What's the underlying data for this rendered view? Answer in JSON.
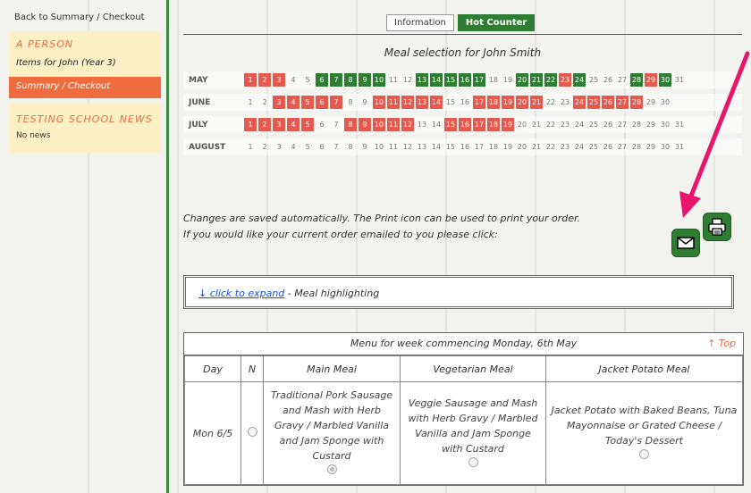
{
  "sidebar": {
    "back_link": "Back to Summary / Checkout",
    "person_heading": "A PERSON",
    "items_label": "Items for John (Year 3)",
    "summary_label": "Summary / Checkout",
    "news_heading": "TESTING SCHOOL NEWS",
    "news_body": "No news"
  },
  "tabs": [
    {
      "label": "Information",
      "active": false
    },
    {
      "label": "Hot Counter",
      "active": true
    }
  ],
  "meal_title": "Meal selection for John Smith",
  "calendar": [
    {
      "month": "MAY",
      "days": 31,
      "red": [
        1,
        2,
        3,
        7,
        8,
        9,
        10,
        13,
        14,
        15,
        16,
        17,
        20,
        21,
        22,
        23,
        24,
        28,
        29,
        30
      ],
      "green": [
        6,
        7,
        8,
        9,
        10,
        13,
        14,
        15,
        16,
        17,
        20,
        21,
        22,
        24,
        28,
        30
      ]
    },
    {
      "month": "JUNE",
      "days": 30,
      "red": [
        3,
        4,
        5,
        6,
        7,
        10,
        11,
        12,
        13,
        14,
        17,
        18,
        19,
        20,
        21,
        24,
        25,
        26,
        27,
        28
      ],
      "green": []
    },
    {
      "month": "JULY",
      "days": 31,
      "red": [
        1,
        2,
        3,
        4,
        5,
        8,
        9,
        10,
        11,
        12,
        15,
        16,
        17,
        18,
        19
      ],
      "green": []
    },
    {
      "month": "AUGUST",
      "days": 31,
      "red": [],
      "green": []
    }
  ],
  "info": {
    "line1": "Changes are saved automatically. The Print icon can be used to print your order.",
    "line2": "If you would like your current order emailed to you please click:"
  },
  "expand": {
    "link": "↓ click to expand",
    "rest": " - Meal highlighting"
  },
  "menu": {
    "heading": "Menu for week commencing Monday, 6th May",
    "top_link": "↑ Top",
    "columns": [
      "Day",
      "N",
      "Main Meal",
      "Vegetarian Meal",
      "Jacket Potato Meal"
    ],
    "rows": [
      {
        "day": "Mon 6/5",
        "main": "Traditional Pork Sausage and Mash with Herb Gravy / Marbled Vanilla and Jam Sponge with Custard",
        "veg": "Veggie Sausage and Mash with Herb Gravy / Marbled Vanilla and Jam Sponge with Custard",
        "jacket": "Jacket Potato with Baked Beans, Tuna Mayonnaise or Grated Cheese / Today's Dessert"
      }
    ]
  },
  "icons": {
    "email": "envelope-icon",
    "print": "printer-icon"
  },
  "colors": {
    "accent_green": "#2e7d32",
    "accent_red": "#e5594f",
    "accent_orange": "#ee6c3d",
    "arrow_pink": "#e8156e"
  }
}
